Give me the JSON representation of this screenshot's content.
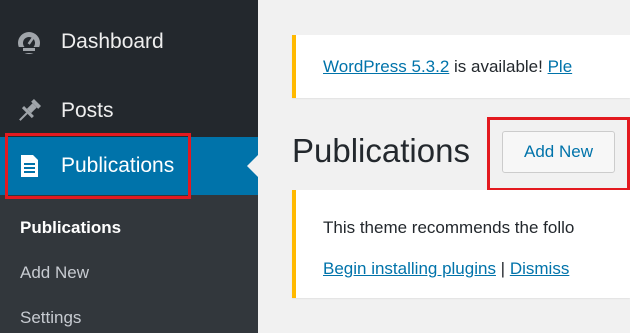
{
  "sidebar": {
    "items": [
      {
        "label": "Dashboard",
        "icon": "dashboard-icon"
      },
      {
        "label": "Posts",
        "icon": "pushpin-icon"
      },
      {
        "label": "Publications",
        "icon": "document-icon",
        "active": true
      }
    ],
    "submenu": [
      {
        "label": "Publications",
        "current": true
      },
      {
        "label": "Add New"
      },
      {
        "label": "Settings"
      }
    ]
  },
  "main": {
    "update_notice": {
      "link_version": "WordPress 5.3.2",
      "text": " is available! ",
      "link_update": "Ple"
    },
    "page_title": "Publications",
    "add_new_label": "Add New",
    "theme_notice": {
      "text": "This theme recommends the follo",
      "link_begin": "Begin installing plugins",
      "separator": " | ",
      "link_dismiss": "Dismiss"
    }
  },
  "colors": {
    "sidebar_bg": "#23282d",
    "submenu_bg": "#32373c",
    "active_bg": "#0073aa",
    "link": "#0073aa",
    "notice_border": "#ffb900",
    "highlight": "#e3191f"
  }
}
